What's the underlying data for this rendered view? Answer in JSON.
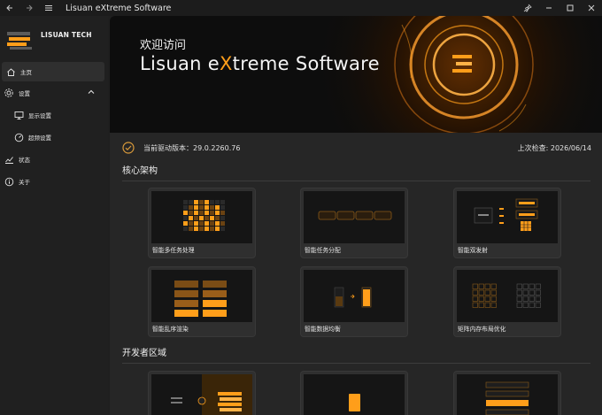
{
  "window": {
    "title": "Lisuan eXtreme Software",
    "icons": [
      "back-arrow-icon",
      "forward-arrow-icon",
      "hamburger-menu-icon",
      "pin-icon",
      "minimize-icon",
      "maximize-icon",
      "close-icon"
    ]
  },
  "sidebar": {
    "brand": "LISUAN TECH",
    "items": [
      {
        "label": "主页",
        "icon": "home-icon",
        "active": true
      },
      {
        "label": "设置",
        "icon": "gear-icon",
        "expanded": true
      },
      {
        "label": "显示设置",
        "icon": "monitor-icon"
      },
      {
        "label": "超频设置",
        "icon": "gauge-icon"
      },
      {
        "label": "状态",
        "icon": "chart-line-icon"
      },
      {
        "label": "关于",
        "icon": "info-icon"
      }
    ]
  },
  "banner": {
    "welcome": "欢迎访问",
    "product_prefix": "Lisuan e",
    "product_accent": "X",
    "product_suffix": "treme Software"
  },
  "status": {
    "driver": "当前驱动版本：29.0.2260.76",
    "last_check": "上次检查: 2026/06/14"
  },
  "sections": {
    "core": "核心架构",
    "developer": "开发者区域"
  },
  "core_cards": [
    {
      "title": "智能多任务处理"
    },
    {
      "title": "智能任务分配"
    },
    {
      "title": "智能双发射"
    },
    {
      "title": "智能乱序渲染"
    },
    {
      "title": "智能数据均衡"
    },
    {
      "title": "矩阵内存布局优化"
    }
  ],
  "colors": {
    "accent": "#ff9e1a",
    "background": "#1f1f1f",
    "panel": "#262626",
    "card": "#2f2f2f"
  }
}
